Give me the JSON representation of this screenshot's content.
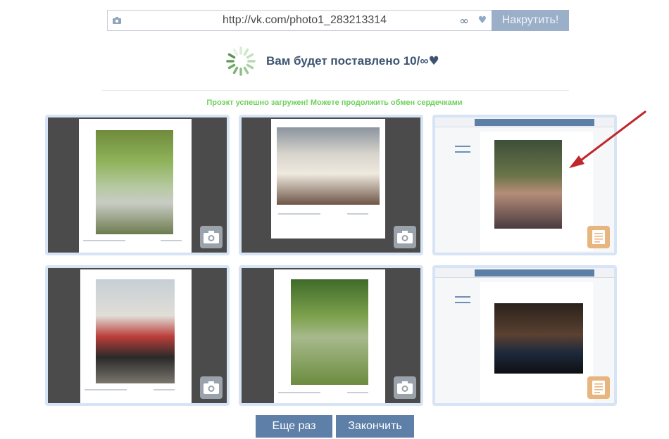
{
  "url_bar": {
    "camera_icon": "camera-icon",
    "url": "http://vk.com/photo1_283213314",
    "infinity": "∞",
    "heart": "♥",
    "submit_label": "Накрутить!"
  },
  "status": {
    "text": "Вам будет поставлено 10/∞",
    "heart": "♥"
  },
  "success_message": "Проэкт успешно загружен! Можете продолжить обмен сердечками",
  "tiles": [
    {
      "type": "photo",
      "badge_icon": "camera-icon"
    },
    {
      "type": "photo",
      "badge_icon": "camera-icon"
    },
    {
      "type": "profile",
      "badge_icon": "document-icon"
    },
    {
      "type": "photo",
      "badge_icon": "camera-icon"
    },
    {
      "type": "photo",
      "badge_icon": "camera-icon"
    },
    {
      "type": "profile",
      "badge_icon": "document-icon"
    }
  ],
  "buttons": {
    "again": "Еще раз",
    "finish": "Закончить"
  },
  "colors": {
    "accent": "#5d7fa8",
    "success": "#6ed05b",
    "tile_border": "#d6e4f5",
    "arrow": "#c0272d"
  }
}
